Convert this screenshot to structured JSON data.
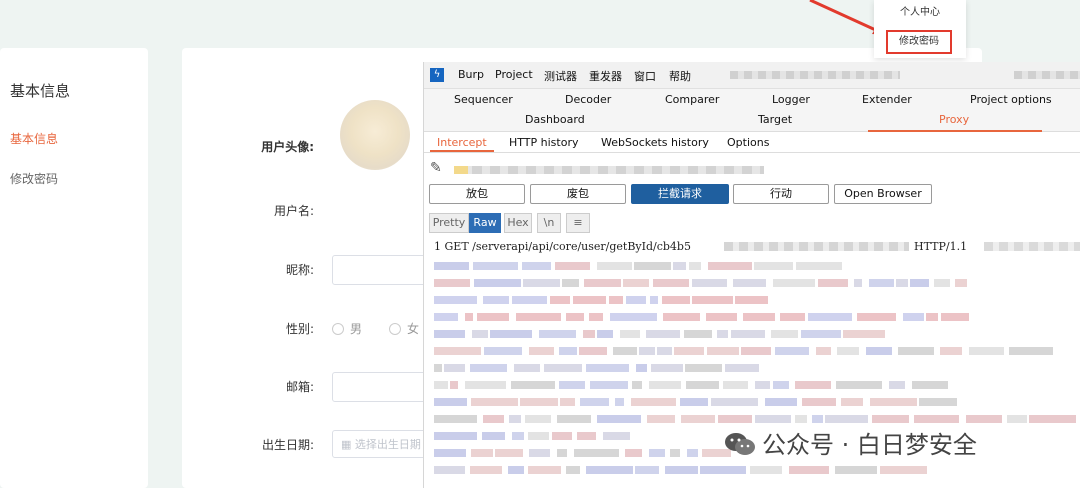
{
  "user_menu": {
    "items": [
      "个人中心",
      "修改密码"
    ]
  },
  "sidebar": {
    "title": "基本信息",
    "items": [
      {
        "label": "基本信息",
        "active": true
      },
      {
        "label": "修改密码",
        "active": false
      }
    ]
  },
  "form": {
    "avatar_label": "用户头像:",
    "username_label": "用户名:",
    "nickname_label": "昵称:",
    "gender_label": "性别:",
    "gender_options": [
      "男",
      "女"
    ],
    "email_label": "邮箱:",
    "birthday_label": "出生日期:",
    "birthday_placeholder": "选择出生日期"
  },
  "burp": {
    "menu": [
      "Burp",
      "Project",
      "测试器",
      "重发器",
      "窗口",
      "帮助"
    ],
    "tabs_row1": [
      "Sequencer",
      "Decoder",
      "Comparer",
      "Logger",
      "Extender",
      "Project options"
    ],
    "tabs_row2": [
      "Dashboard",
      "Target",
      "Proxy"
    ],
    "active_tab": "Proxy",
    "subtabs": [
      "Intercept",
      "HTTP history",
      "WebSockets history",
      "Options"
    ],
    "active_subtab": "Intercept",
    "buttons": [
      "放包",
      "废包",
      "拦截请求",
      "行动",
      "Open Browser"
    ],
    "format_buttons": [
      "Pretty",
      "Raw",
      "Hex",
      "\\n",
      "≡"
    ],
    "active_format": "Raw",
    "request_line_number": "1",
    "request_line": "GET /serverapi/api/core/user/getById/cb4b5",
    "request_protocol": "HTTP/1.1"
  },
  "watermark": {
    "text": "公众号 · 白日梦安全"
  },
  "colors": {
    "accent": "#e8663d",
    "primary_button": "#1f5f9f",
    "highlight_red": "#e23a2d"
  }
}
